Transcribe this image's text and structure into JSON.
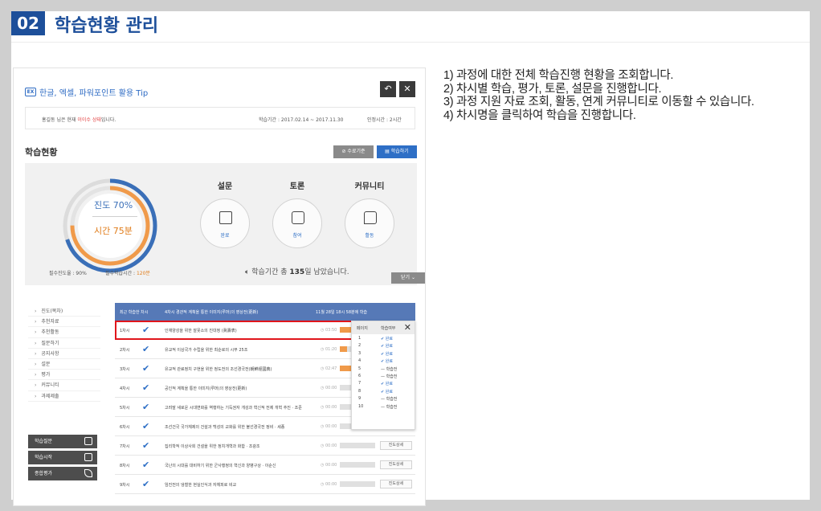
{
  "header": {
    "number": "02",
    "title": "학습현황 관리"
  },
  "notes": [
    "1) 과정에 대한 전체 학습진행 현황을 조회합니다.",
    "2) 차시별 학습, 평가, 토론, 설문을 진행합니다.",
    "3) 과정 지원 자료 조회, 활동, 연계 커뮤니티로 이동할 수 있습니다.",
    "4) 차시명을 클릭하여 학습을 진행합니다."
  ],
  "screen": {
    "tip_icon": "EX",
    "course_title": "한글, 엑셀, 파워포인트 활용 Tip",
    "greeting_prefix": "홍길동 님은 현재 ",
    "greeting_status": "이이수 상태",
    "greeting_suffix": "입니다.",
    "period": "학습기간 : 2017.02.14 ~ 2017.11.30",
    "recognized_hours": "인정시간 : 2시간",
    "status_heading": "학습현황",
    "btn_criteria": "수료기준",
    "btn_study": "학습하기",
    "progress": "진도 70%",
    "time": "시간 75분",
    "progress_fraction": 0.7,
    "time_fraction": 0.75,
    "required_progress": "필수진도율 : 90%",
    "required_time_label": "필수학습시간 : ",
    "required_time_value": "120분",
    "survey": {
      "label": "설문",
      "caption": "완료"
    },
    "discussion": {
      "label": "토론",
      "caption": "참여"
    },
    "community": {
      "label": "커뮤니티",
      "caption": "활동"
    },
    "remaining_prefix": "학습기간 총 ",
    "remaining_days": "135",
    "remaining_suffix": "일 남았습니다.",
    "close_label": "닫기 ⌄",
    "sidebar": [
      "진도(목차)",
      "추천자료",
      "추천활동",
      "질문하기",
      "공지사항",
      "설문",
      "평가",
      "커뮤니티",
      "과제제출"
    ],
    "side_buttons": [
      "학습질문",
      "학습시작",
      "종합평가"
    ],
    "table_header": {
      "recent": "최근 학습한 차시",
      "current": "4차시  경관적 계획을 통한 이미지(루머)의 영상전(更新)",
      "date": "11월 28일 18시 58분에 학습"
    },
    "rows": [
      {
        "no": "1차시",
        "name": "인재양성을 위한 잘못소의 진대정 (眞壽表)",
        "time": "03:50",
        "fill": 0.45,
        "detail": ""
      },
      {
        "no": "2차시",
        "name": "유교적 이상국가 수립을 위한 최순로의 시무 25조",
        "time": "01:20",
        "fill": 0.2,
        "detail": ""
      },
      {
        "no": "3차시",
        "name": "유교적 관료정치 구현을 위한 정도전의 조선경국전(朝鮮經國典)",
        "time": "02:47",
        "fill": 0.35,
        "detail": ""
      },
      {
        "no": "4차시",
        "name": "공인적 계획을 통한 이미지(루머)의 영상전(更新)",
        "time": "00:00",
        "fill": 0.0,
        "detail": ""
      },
      {
        "no": "5차시",
        "name": "고려말 새로운 시대변화를 역행하는 기득권자 개성과 혁신적 전제 개혁 추진 · 조준",
        "time": "00:00",
        "fill": 0.0,
        "detail": ""
      },
      {
        "no": "6차시",
        "name": "조선건국 국가체제의 건설과 백성의 교화를 위한 불선경국전 정비 · 세종",
        "time": "00:00",
        "fill": 0.0,
        "detail": ""
      },
      {
        "no": "7차시",
        "name": "집리학적 이상사회 건설을 위한 정치개혁과 화합 · 조광조",
        "time": "00:00",
        "fill": 0.0,
        "detail": "진도상세"
      },
      {
        "no": "8차시",
        "name": "국난의 시대를 대비하기 위한 군사행정의 혁신과 양병구상 · 이순신",
        "time": "00:00",
        "fill": 0.0,
        "detail": "진도상세"
      },
      {
        "no": "9차시",
        "name": "임진전의 냉철한 현실인식과 자체피로 비교",
        "time": "00:00",
        "fill": 0.0,
        "detail": "진도상세"
      }
    ],
    "popup": {
      "col_page": "페이지",
      "col_status": "학습여부",
      "items": [
        {
          "n": "1",
          "s": "✔ 완료",
          "done": true
        },
        {
          "n": "2",
          "s": "✔ 완료",
          "done": true
        },
        {
          "n": "3",
          "s": "✔ 완료",
          "done": true
        },
        {
          "n": "4",
          "s": "✔ 완료",
          "done": true
        },
        {
          "n": "5",
          "s": "— 학습전",
          "done": false
        },
        {
          "n": "6",
          "s": "— 학습전",
          "done": false
        },
        {
          "n": "7",
          "s": "✔ 완료",
          "done": true
        },
        {
          "n": "8",
          "s": "✔ 완료",
          "done": true
        },
        {
          "n": "9",
          "s": "— 학습전",
          "done": false
        },
        {
          "n": "10",
          "s": "— 학습전",
          "done": false
        }
      ]
    }
  },
  "colors": {
    "brand": "#1d4f9a",
    "accent_blue": "#2e6fc6",
    "accent_orange": "#e07c1a",
    "highlight": "#e0161c"
  }
}
